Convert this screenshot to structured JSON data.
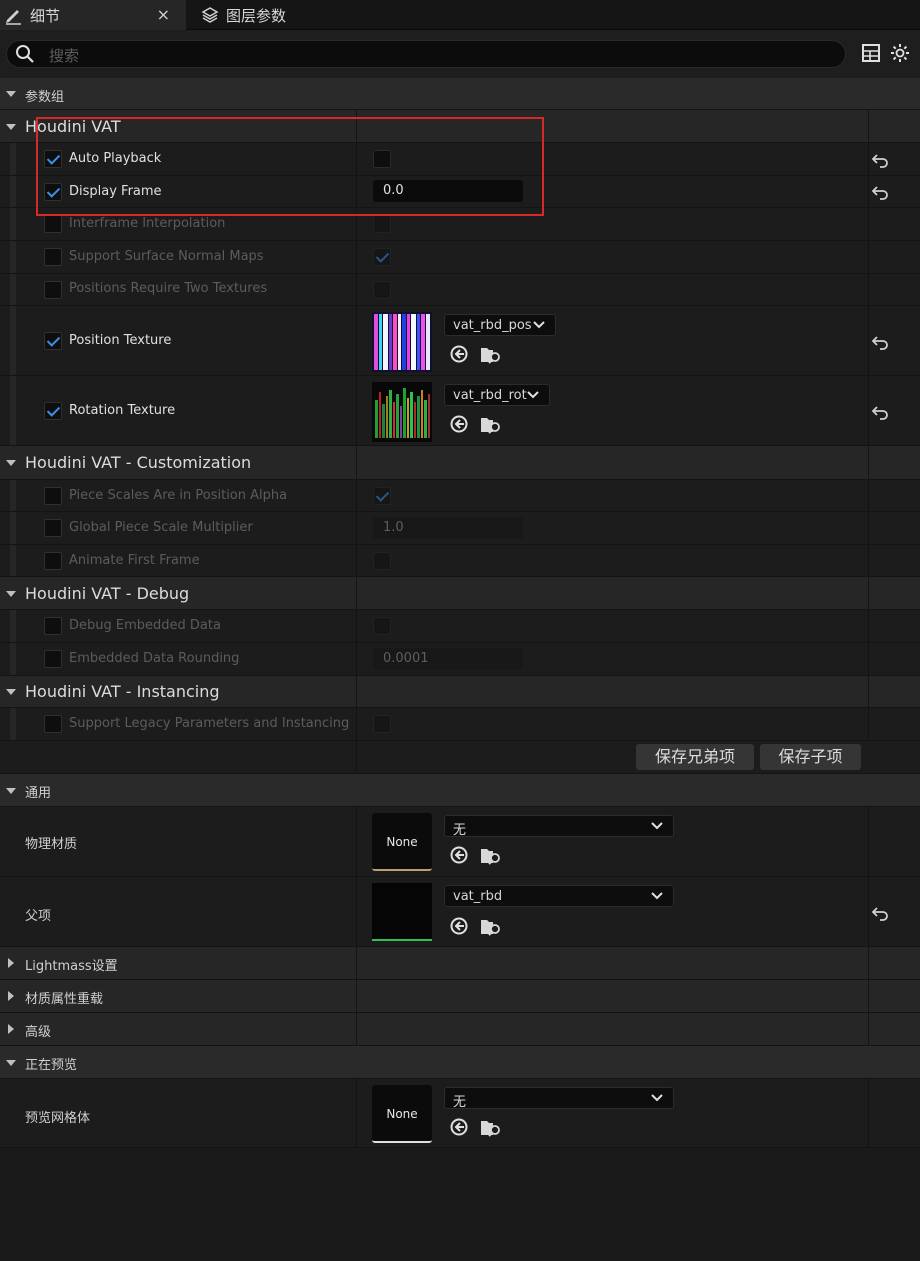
{
  "tabs": {
    "details": {
      "label": "细节",
      "close": "×"
    },
    "layer_params": {
      "label": "图层参数"
    }
  },
  "search": {
    "placeholder": "搜索"
  },
  "groups": {
    "param_group": "参数组",
    "houdini_vat": "Houdini VAT",
    "customization": "Houdini VAT - Customization",
    "debug": "Houdini VAT - Debug",
    "instancing": "Houdini VAT - Instancing",
    "general": "通用",
    "lightmass": "Lightmass设置",
    "material_override": "材质属性重载",
    "advanced": "高级",
    "previewing": "正在预览"
  },
  "params": [
    {
      "label": "Auto Playback",
      "enabled": true,
      "type": "bool",
      "value": false
    },
    {
      "label": "Display Frame",
      "enabled": true,
      "type": "number",
      "value": "0.0"
    },
    {
      "label": "Interframe Interpolation",
      "enabled": false,
      "type": "bool",
      "value": false
    },
    {
      "label": "Support Surface Normal Maps",
      "enabled": false,
      "type": "bool",
      "value": true
    },
    {
      "label": "Positions Require Two Textures",
      "enabled": false,
      "type": "bool",
      "value": false
    },
    {
      "label": "Position Texture",
      "enabled": true,
      "type": "texture",
      "value": "vat_rbd_pos"
    },
    {
      "label": "Rotation Texture",
      "enabled": true,
      "type": "texture",
      "value": "vat_rbd_rot"
    },
    {
      "label": "Piece Scales Are in Position Alpha",
      "enabled": false,
      "type": "bool",
      "value": true
    },
    {
      "label": "Global Piece Scale Multiplier",
      "enabled": false,
      "type": "number",
      "value": "1.0"
    },
    {
      "label": "Animate First Frame",
      "enabled": false,
      "type": "bool",
      "value": false
    },
    {
      "label": "Debug Embedded Data",
      "enabled": false,
      "type": "bool",
      "value": false
    },
    {
      "label": "Embedded Data Rounding",
      "enabled": false,
      "type": "number",
      "value": "0.0001"
    },
    {
      "label": "Support Legacy Parameters and Instancing",
      "enabled": false,
      "type": "bool",
      "value": false
    }
  ],
  "buttons": {
    "save_sibling": "保存兄弟项",
    "save_child": "保存子项"
  },
  "general": {
    "phys_material": {
      "label": "物理材质",
      "thumb": "None",
      "value": "无"
    },
    "parent": {
      "label": "父项",
      "value": "vat_rbd"
    }
  },
  "preview": {
    "mesh": {
      "label": "预览网格体",
      "thumb": "None",
      "value": "无"
    }
  },
  "colors": {
    "accent": "#3b8fe8",
    "highlight_box": "#d42a2a",
    "panel": "#1c1c1c"
  }
}
